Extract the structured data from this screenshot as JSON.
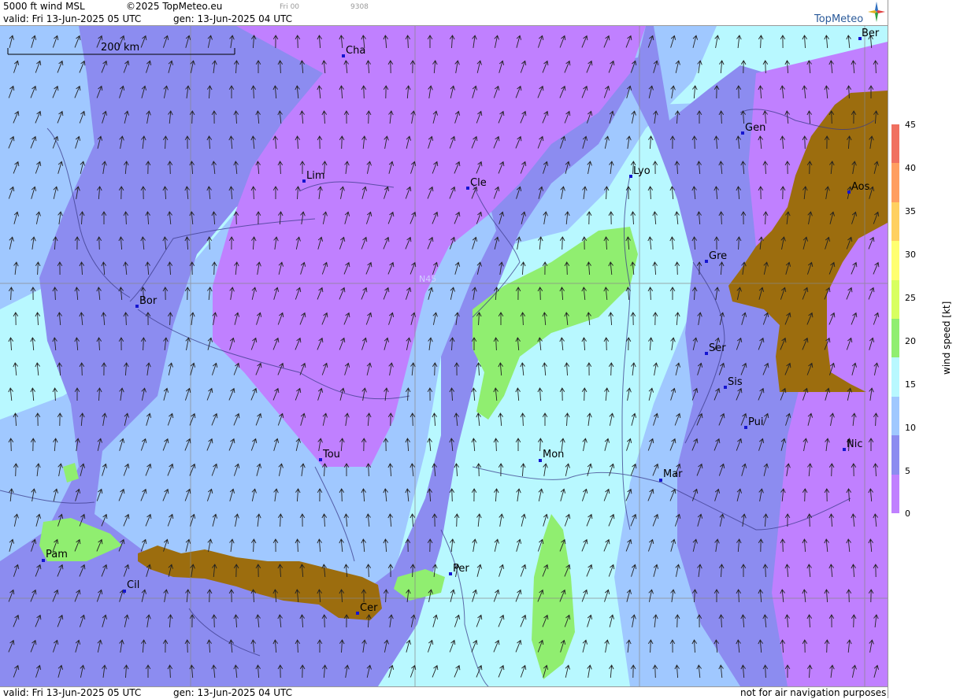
{
  "header": {
    "title": "5000 ft wind MSL",
    "copyright": "©2025 TopMeteo.eu",
    "valid": "valid:  Fri  13-Jun-2025  05 UTC",
    "gen": "gen: 13-Jun-2025 04 UTC",
    "run": "Fri 00",
    "code": "9308",
    "brand": "TopMeteo"
  },
  "footer": {
    "valid": "valid:  Fri  13-Jun-2025  05 UTC",
    "gen": "gen: 13-Jun-2025 04 UTC",
    "disclaimer": "not for air navigation purposes"
  },
  "map": {
    "scale_label": "200 km",
    "grid_label": "N45",
    "cities": [
      {
        "name": "Cha"
      },
      {
        "name": "Lim"
      },
      {
        "name": "Cle"
      },
      {
        "name": "Lyo"
      },
      {
        "name": "Gen"
      },
      {
        "name": "Aos"
      },
      {
        "name": "Gre"
      },
      {
        "name": "Bor"
      },
      {
        "name": "Ser"
      },
      {
        "name": "Sis"
      },
      {
        "name": "Pui"
      },
      {
        "name": "Nic"
      },
      {
        "name": "Tou"
      },
      {
        "name": "Mon"
      },
      {
        "name": "Mar"
      },
      {
        "name": "Pam"
      },
      {
        "name": "Cil"
      },
      {
        "name": "Per"
      },
      {
        "name": "Cer"
      },
      {
        "name": "Ber"
      }
    ]
  },
  "legend": {
    "unit": "wind  speed  [kt]",
    "ticks": [
      "45",
      "40",
      "35",
      "30",
      "25",
      "20",
      "15",
      "10",
      "5",
      "0"
    ],
    "colors": [
      "#f07060",
      "#ff9e60",
      "#ffd060",
      "#ffff70",
      "#d8ff60",
      "#90ee70",
      "#b8f8ff",
      "#a0c8ff",
      "#8c8cf0",
      "#c080ff"
    ]
  }
}
